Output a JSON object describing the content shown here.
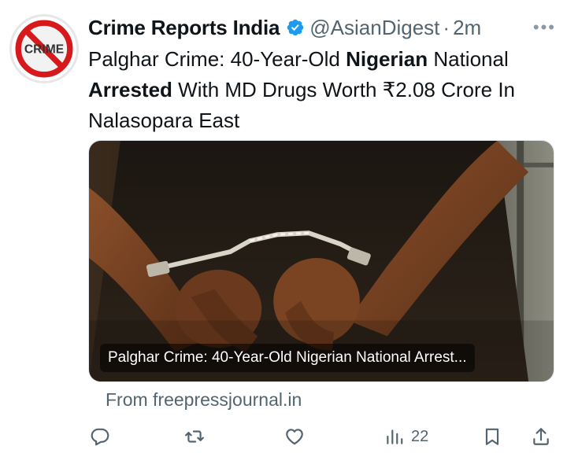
{
  "colors": {
    "verified_badge": "#1d9bf0",
    "secondary_text": "#536471",
    "primary_text": "#0f1419",
    "avatar_red": "#d7191c"
  },
  "tweet": {
    "avatar": {
      "text": "CRIME",
      "icon": "no-crime-sign-icon"
    },
    "display_name": "Crime Reports India",
    "verified_icon": "verified-badge-icon",
    "handle": "@AsianDigest",
    "separator": "·",
    "time": "2m",
    "more_icon": "more-icon",
    "text_segments": [
      {
        "text": "Palghar Crime: 40-Year-Old ",
        "bold": false
      },
      {
        "text": "Nigerian",
        "bold": true
      },
      {
        "text": " National ",
        "bold": false
      },
      {
        "text": "Arrested",
        "bold": true
      },
      {
        "text": " With MD Drugs Worth ₹2.08 Crore In Nalasopara East",
        "bold": false
      }
    ],
    "card": {
      "image": "handcuffed-hands-photo",
      "title": "Palghar Crime: 40-Year-Old Nigerian National Arrest..."
    },
    "source": "From freepressjournal.in",
    "actions": {
      "reply_icon": "reply-icon",
      "retweet_icon": "retweet-icon",
      "like_icon": "like-icon",
      "views_icon": "views-icon",
      "views_count": "22",
      "bookmark_icon": "bookmark-icon",
      "share_icon": "share-icon"
    }
  }
}
